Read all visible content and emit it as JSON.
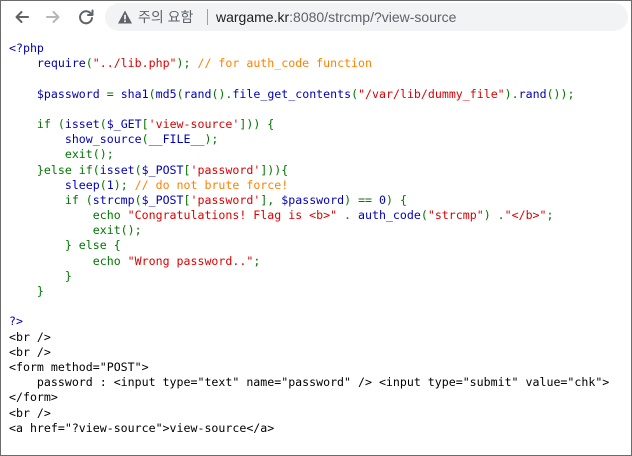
{
  "browser": {
    "security_warning": "주의 요함",
    "url_host": "wargame.kr",
    "url_rest": ":8080/strcmp/?view-source"
  },
  "colors": {
    "default": "#0000bb",
    "keyword": "#007700",
    "string": "#dd0000",
    "comment": "#ff8000",
    "html": "#000000"
  },
  "source_lines": [
    [
      [
        "df",
        "<?php"
      ]
    ],
    [
      [
        "df",
        "    require"
      ],
      [
        "kw",
        "("
      ],
      [
        "st",
        "\"../lib.php\""
      ],
      [
        "kw",
        ");"
      ],
      [
        "cm",
        " // for auth_code function"
      ]
    ],
    [],
    [
      [
        "df",
        "    $password "
      ],
      [
        "kw",
        "= "
      ],
      [
        "df",
        "sha1"
      ],
      [
        "kw",
        "("
      ],
      [
        "df",
        "md5"
      ],
      [
        "kw",
        "("
      ],
      [
        "df",
        "rand"
      ],
      [
        "kw",
        "()."
      ],
      [
        "df",
        "file_get_contents"
      ],
      [
        "kw",
        "("
      ],
      [
        "st",
        "\"/var/lib/dummy_file\""
      ],
      [
        "kw",
        ")."
      ],
      [
        "df",
        "rand"
      ],
      [
        "kw",
        "());"
      ]
    ],
    [],
    [
      [
        "kw",
        "    if ("
      ],
      [
        "df",
        "isset"
      ],
      [
        "kw",
        "("
      ],
      [
        "df",
        "$_GET"
      ],
      [
        "kw",
        "["
      ],
      [
        "st",
        "'view-source'"
      ],
      [
        "kw",
        "])) {"
      ]
    ],
    [
      [
        "df",
        "        show_source"
      ],
      [
        "kw",
        "("
      ],
      [
        "df",
        "__FILE__"
      ],
      [
        "kw",
        ");"
      ]
    ],
    [
      [
        "kw",
        "        exit();"
      ]
    ],
    [
      [
        "kw",
        "    }else if("
      ],
      [
        "df",
        "isset"
      ],
      [
        "kw",
        "("
      ],
      [
        "df",
        "$_POST"
      ],
      [
        "kw",
        "["
      ],
      [
        "st",
        "'password'"
      ],
      [
        "kw",
        "])){"
      ]
    ],
    [
      [
        "df",
        "        sleep"
      ],
      [
        "kw",
        "("
      ],
      [
        "df",
        "1"
      ],
      [
        "kw",
        ");"
      ],
      [
        "cm",
        " // do not brute force!"
      ]
    ],
    [
      [
        "kw",
        "        if ("
      ],
      [
        "df",
        "strcmp"
      ],
      [
        "kw",
        "("
      ],
      [
        "df",
        "$_POST"
      ],
      [
        "kw",
        "["
      ],
      [
        "st",
        "'password'"
      ],
      [
        "kw",
        "], "
      ],
      [
        "df",
        "$password"
      ],
      [
        "kw",
        ") == "
      ],
      [
        "df",
        "0"
      ],
      [
        "kw",
        ") {"
      ]
    ],
    [
      [
        "kw",
        "            echo "
      ],
      [
        "st",
        "\"Congratulations! Flag is <b>\""
      ],
      [
        "kw",
        " . "
      ],
      [
        "df",
        "auth_code"
      ],
      [
        "kw",
        "("
      ],
      [
        "st",
        "\"strcmp\""
      ],
      [
        "kw",
        ") ."
      ],
      [
        "st",
        "\"</b>\""
      ],
      [
        "kw",
        ";"
      ]
    ],
    [
      [
        "kw",
        "            exit();"
      ]
    ],
    [
      [
        "kw",
        "        } else {"
      ]
    ],
    [
      [
        "kw",
        "            echo "
      ],
      [
        "st",
        "\"Wrong password..\""
      ],
      [
        "kw",
        ";"
      ]
    ],
    [
      [
        "kw",
        "        }"
      ]
    ],
    [
      [
        "kw",
        "    }"
      ]
    ],
    [],
    [
      [
        "df",
        "?>"
      ]
    ],
    [
      [
        "tx",
        "<br />"
      ]
    ],
    [
      [
        "tx",
        "<br />"
      ]
    ],
    [
      [
        "tx",
        "<form method=\"POST\">"
      ]
    ],
    [
      [
        "tx",
        "    password : <input type=\"text\" name=\"password\" /> <input type=\"submit\" value=\"chk\">"
      ]
    ],
    [
      [
        "tx",
        "</form>"
      ]
    ],
    [
      [
        "tx",
        "<br />"
      ]
    ],
    [
      [
        "tx",
        "<a href=\"?view-source\">view-source</a>"
      ]
    ]
  ]
}
